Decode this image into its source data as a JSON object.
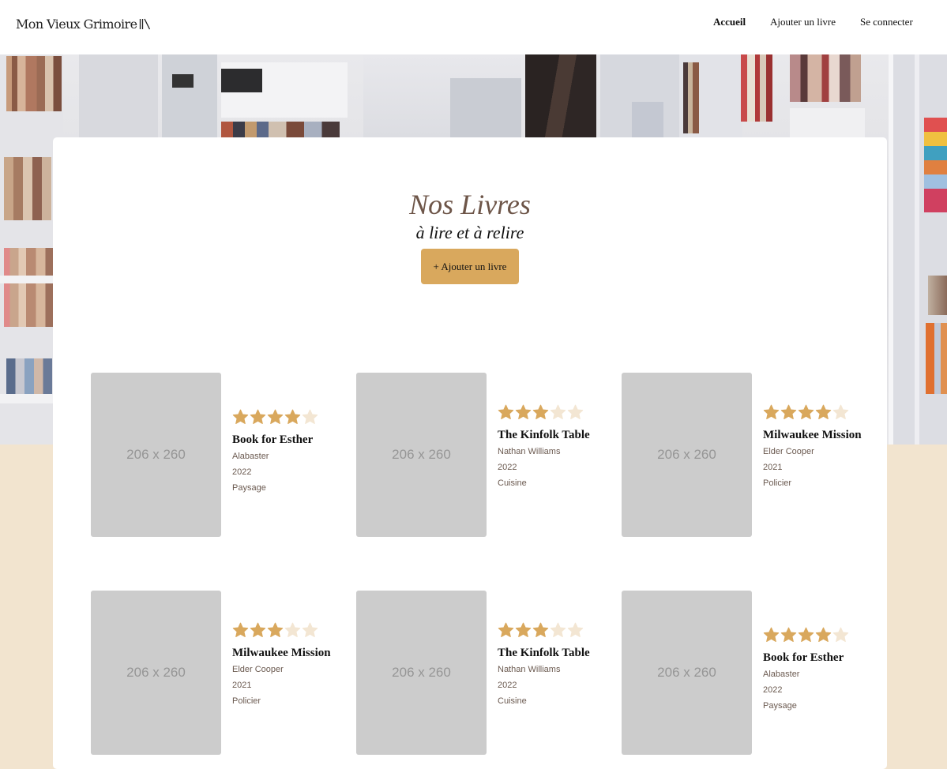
{
  "header": {
    "logo_text": "Mon Vieux Grimoire",
    "nav": [
      {
        "label": "Accueil",
        "active": true
      },
      {
        "label": "Ajouter un livre",
        "active": false
      },
      {
        "label": "Se connecter",
        "active": false
      }
    ]
  },
  "main": {
    "title": "Nos Livres",
    "subtitle": "à lire et à relire",
    "add_button": "+ Ajouter un livre"
  },
  "colors": {
    "accent": "#d9a85d",
    "star_filled": "#d9a85d",
    "star_empty": "#f3e6d3",
    "page_bg": "#f2e4cf",
    "title_color": "#6d5548"
  },
  "books": [
    {
      "cover_text": "206 x 260",
      "rating": 4,
      "max_rating": 5,
      "title": "Book for Esther",
      "author": "Alabaster",
      "year": "2022",
      "genre": "Paysage"
    },
    {
      "cover_text": "206 x 260",
      "rating": 3,
      "max_rating": 5,
      "title": "The Kinfolk Table",
      "author": "Nathan Williams",
      "year": "2022",
      "genre": "Cuisine"
    },
    {
      "cover_text": "206 x 260",
      "rating": 4,
      "max_rating": 5,
      "title": "Milwaukee Mission",
      "author": "Elder Cooper",
      "year": "2021",
      "genre": "Policier"
    },
    {
      "cover_text": "206 x 260",
      "rating": 3,
      "max_rating": 5,
      "title": "Milwaukee Mission",
      "author": "Elder Cooper",
      "year": "2021",
      "genre": "Policier"
    },
    {
      "cover_text": "206 x 260",
      "rating": 3,
      "max_rating": 5,
      "title": "The Kinfolk Table",
      "author": "Nathan Williams",
      "year": "2022",
      "genre": "Cuisine"
    },
    {
      "cover_text": "206 x 260",
      "rating": 4,
      "max_rating": 5,
      "title": "Book for Esther",
      "author": "Alabaster",
      "year": "2022",
      "genre": "Paysage"
    }
  ]
}
